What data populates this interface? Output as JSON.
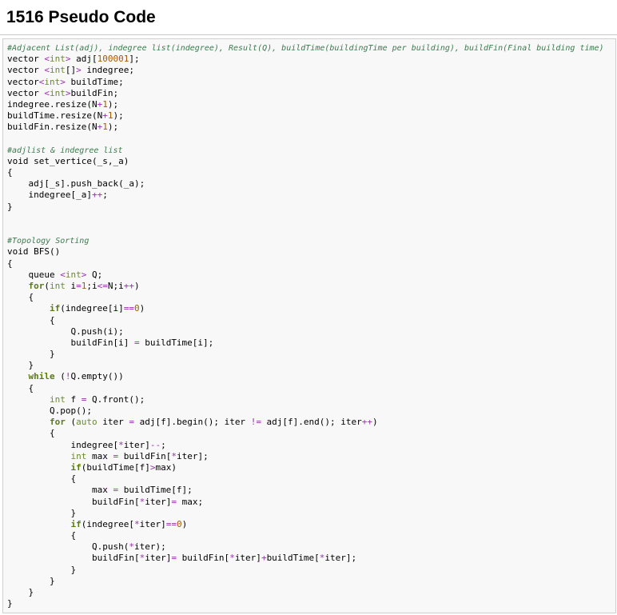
{
  "page": {
    "title": "1516 Pseudo Code"
  },
  "code": {
    "language": "cpp",
    "lines": [
      "#Adjacent List(adj), indegree list(indegree), Result(Q), buildTime(buildingTime per building), buildFin(Final building time)",
      "vector <int> adj[100001];",
      "vector <int[]> indegree;",
      "vector<int> buildTime;",
      "vector <int>buildFin;",
      "indegree.resize(N+1);",
      "buildTime.resize(N+1);",
      "buildFin.resize(N+1);",
      "",
      "#adjlist & indegree list",
      "void set_vertice(_s,_a)",
      "{",
      "    adj[_s].push_back(_a);",
      "    indegree[_a]++;",
      "}",
      "",
      "",
      "#Topology Sorting",
      "void BFS()",
      "{",
      "    queue <int> Q;",
      "    for(int i=1;i<=N;i++)",
      "    {",
      "        if(indegree[i]==0)",
      "        {",
      "            Q.push(i);",
      "            buildFin[i] = buildTime[i];",
      "        }",
      "    }",
      "    while (!Q.empty())",
      "    {",
      "        int f = Q.front();",
      "        Q.pop();",
      "        for (auto iter = adj[f].begin(); iter != adj[f].end(); iter++)",
      "        {",
      "            indegree[*iter]--;",
      "            int max = buildFin[*iter];",
      "            if(buildTime[f]>max)",
      "            {",
      "                max = buildTime[f];",
      "                buildFin[*iter]= max;",
      "            }",
      "            if(indegree[*iter]==0)",
      "            {",
      "                Q.push(*iter);",
      "                buildFin[*iter]= buildFin[*iter]+buildTime[*iter];",
      "            }",
      "        }",
      "    }",
      "}"
    ]
  },
  "colors": {
    "comment": "#3c7a4e",
    "type": "#6a8a32",
    "keyword": "#5a7a16",
    "number": "#a35a00",
    "operator": "#9a2fb0",
    "code_background": "#f8f8f8",
    "border": "#cfcfcf"
  }
}
